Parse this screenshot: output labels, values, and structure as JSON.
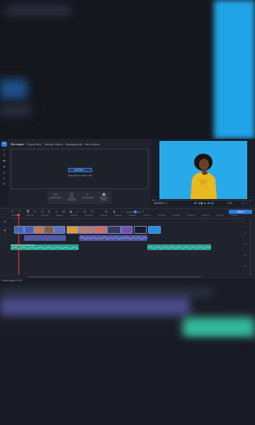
{
  "colors": {
    "accent": "#2f7be0",
    "video_bg": "#28a9e9",
    "audio_clip": "#2ca396",
    "video_audio": "#5257a6",
    "playhead": "#ff3b3b",
    "app_bg": "#20232d"
  },
  "import_tabs": [
    "File import",
    "Project files",
    "Sample videos",
    "Backgrounds",
    "Intro videos"
  ],
  "drop_zone": {
    "add_files_label": "Add files",
    "hint": "Drag files or folders here"
  },
  "quick_actions": [
    {
      "icon": "record-video-icon",
      "glyph": "▭",
      "label": "Record Video"
    },
    {
      "icon": "capture-screencast-icon",
      "glyph": "▢",
      "label": "Capture Screencast"
    },
    {
      "icon": "record-audio-icon",
      "glyph": "♪",
      "label": "Record Audio"
    },
    {
      "icon": "slideshow-wizard-icon",
      "glyph": "▣",
      "label": "Slideshow Wizard"
    }
  ],
  "player": {
    "time": "00:00:02",
    "duration": "/3:25",
    "zoom": "16:9",
    "progress": 0.02
  },
  "timeline": {
    "export_label": "Export",
    "ruler_ticks": [
      "00:00:00",
      "00:00:05",
      "00:00:10",
      "00:00:15",
      "00:00:20",
      "00:00:25",
      "00:00:30",
      "00:00:35",
      "00:00:40",
      "00:00:45",
      "00:00:50",
      "00:00:55",
      "00:01:00",
      "00:01:05",
      "00:01:10",
      "00:01:15"
    ],
    "audio_clip_1": "Motivational_Corp_Mid.mp3",
    "zoom_level": 0.5
  },
  "status": {
    "project_length": "Project length: 03:30"
  }
}
